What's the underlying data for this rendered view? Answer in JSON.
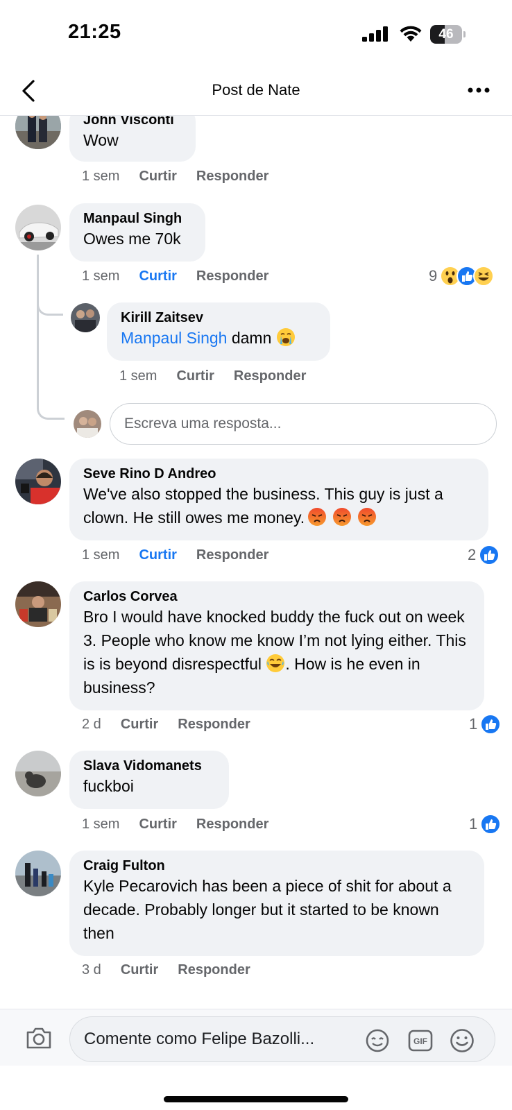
{
  "status_bar": {
    "time": "21:25",
    "battery": "46",
    "battery_level": 0.46
  },
  "nav": {
    "title": "Post de Nate"
  },
  "comments": [
    {
      "author": "John Visconti",
      "text": "Wow",
      "time": "1 sem",
      "like": "Curtir",
      "reply": "Responder"
    },
    {
      "author": "Manpaul Singh",
      "text": "Owes me 70k",
      "time": "1 sem",
      "like": "Curtir",
      "reply": "Responder",
      "reaction_count": "9"
    },
    {
      "author": "Kirill Zaitsev",
      "mention": "Manpaul Singh",
      "text": " damn",
      "time": "1 sem",
      "like": "Curtir",
      "reply": "Responder"
    },
    {
      "author": "Seve Rino D Andreo",
      "text": "We've also stopped the business. This guy is just a clown. He still owes me money.",
      "time": "1 sem",
      "like": "Curtir",
      "reply": "Responder",
      "reaction_count": "2"
    },
    {
      "author": "Carlos Corvea",
      "text_part1": "Bro I would have knocked buddy the fuck out on week 3. People who know me know I’m not lying either. This is is beyond disrespectful ",
      "text_part2": ". How is he even in business?",
      "time": "2 d",
      "like": "Curtir",
      "reply": "Responder",
      "reaction_count": "1"
    },
    {
      "author": "Slava Vidomanets",
      "text": "fuckboi",
      "time": "1 sem",
      "like": "Curtir",
      "reply": "Responder",
      "reaction_count": "1"
    },
    {
      "author": "Craig Fulton",
      "text": "Kyle Pecarovich has been a piece of shit for about a decade. Probably longer but it started to be known then",
      "time": "3 d",
      "like": "Curtir",
      "reply": "Responder"
    }
  ],
  "reply_input": {
    "placeholder": "Escreva uma resposta..."
  },
  "comment_bar": {
    "placeholder": "Comente como Felipe Bazolli..."
  },
  "colors": {
    "accent": "#1877f2",
    "bubble": "#f0f2f5",
    "muted": "#65676b"
  }
}
